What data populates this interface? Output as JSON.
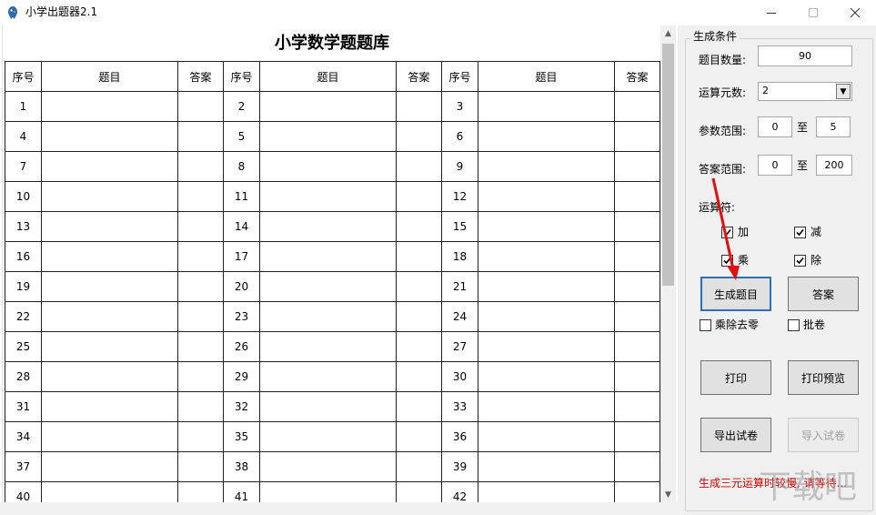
{
  "window": {
    "title": "小学出题器2.1",
    "icon": "parrot-app-icon",
    "minimize_icon": "minimize-icon",
    "maximize_icon": "maximize-icon",
    "close_icon": "close-icon"
  },
  "sheet": {
    "title": "小学数学题题库",
    "headers": {
      "seq": "序号",
      "question": "题目",
      "answer": "答案"
    },
    "rows": [
      [
        "1",
        "2",
        "3"
      ],
      [
        "4",
        "5",
        "6"
      ],
      [
        "7",
        "8",
        "9"
      ],
      [
        "10",
        "11",
        "12"
      ],
      [
        "13",
        "14",
        "15"
      ],
      [
        "16",
        "17",
        "18"
      ],
      [
        "19",
        "20",
        "21"
      ],
      [
        "22",
        "23",
        "24"
      ],
      [
        "25",
        "26",
        "27"
      ],
      [
        "28",
        "29",
        "30"
      ],
      [
        "31",
        "32",
        "33"
      ],
      [
        "34",
        "35",
        "36"
      ],
      [
        "37",
        "38",
        "39"
      ],
      [
        "40",
        "41",
        "42"
      ]
    ]
  },
  "panel": {
    "group_title": "生成条件",
    "count_label": "题目数量:",
    "count_value": "90",
    "operand_label": "运算元数:",
    "operand_value": "2",
    "param_label": "参数范围:",
    "param_min": "0",
    "param_max": "5",
    "answer_label": "答案范围:",
    "answer_min": "0",
    "answer_max": "200",
    "to_text": "至",
    "ops_label": "运算符:",
    "ops": {
      "add": "加",
      "sub": "减",
      "mul": "乘",
      "div": "除"
    },
    "ops_checked": {
      "add": true,
      "sub": true,
      "mul": true,
      "div": true
    },
    "generate_btn": "生成题目",
    "answer_btn": "答案",
    "remove_zero": "乘除去零",
    "grade": "批卷",
    "print_btn": "打印",
    "preview_btn": "打印预览",
    "export_btn": "导出试卷",
    "import_btn": "导入试卷",
    "hint": "生成三元运算时较慢, 请等待..."
  },
  "watermark_text": "下载吧",
  "colors": {
    "accent_red": "#d40000",
    "focus_blue": "#2f6fb5",
    "panel_bg": "#f0f0f0"
  }
}
